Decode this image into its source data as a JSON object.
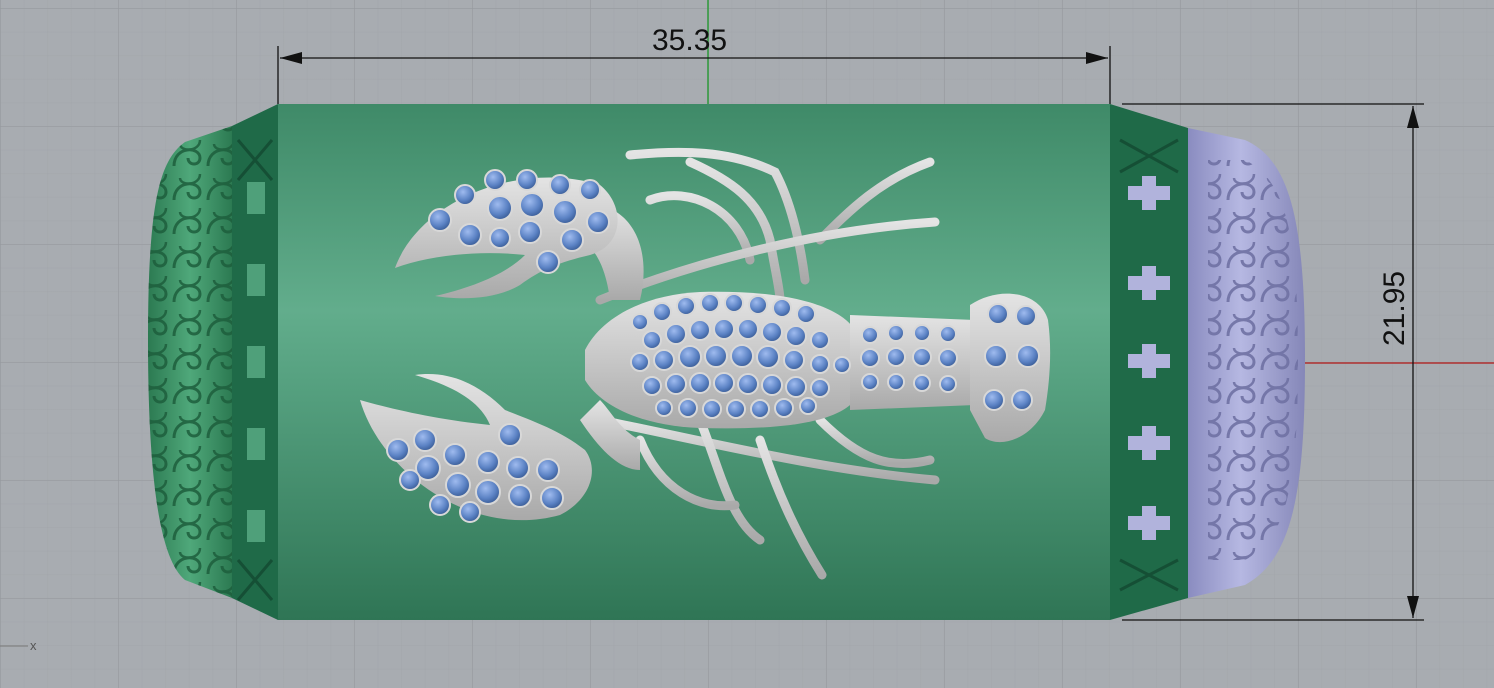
{
  "viewport": {
    "background_color": "#a8acb1",
    "grid_color": "#96999e"
  },
  "dimensions": {
    "width": {
      "value": "35.35"
    },
    "height": {
      "value": "21.95"
    }
  },
  "axis": {
    "x_label": "x",
    "x_axis_color": "#b03030",
    "y_axis_color": "#2e9a3a"
  },
  "model": {
    "band_color": "#4f9a78",
    "shoulder_color": "#1f6a48",
    "side_panel_left_color": "#3e9a6a",
    "side_panel_right_color": "#a7a9d6",
    "metal_color": "#c9c9c9",
    "gem_color": "#5b82c4"
  }
}
